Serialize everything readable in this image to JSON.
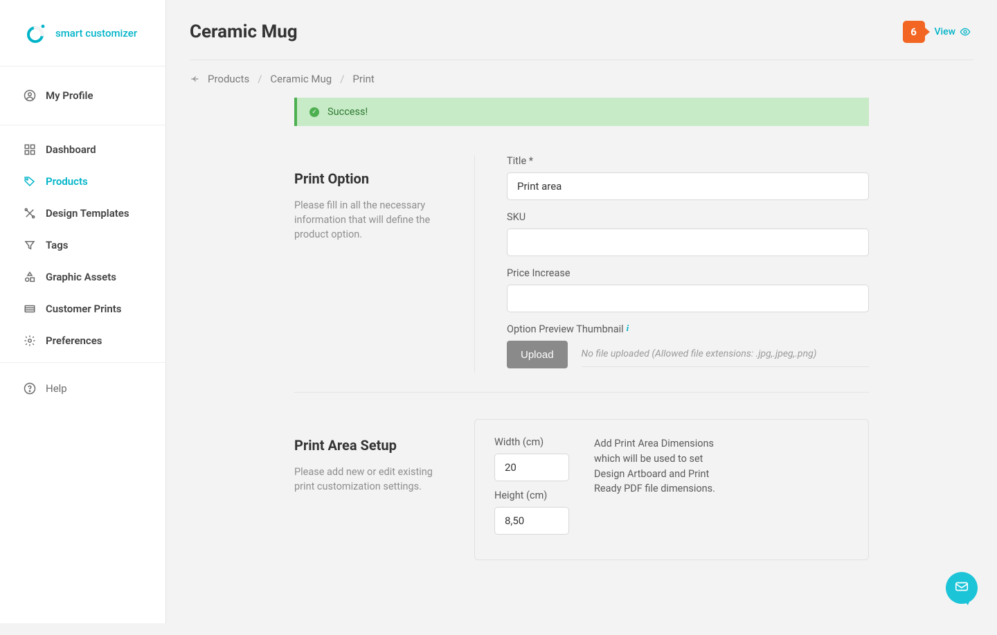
{
  "brand": {
    "name": "smart customizer"
  },
  "sidebar": {
    "profile": "My Profile",
    "items": [
      {
        "label": "Dashboard"
      },
      {
        "label": "Products"
      },
      {
        "label": "Design Templates"
      },
      {
        "label": "Tags"
      },
      {
        "label": "Graphic Assets"
      },
      {
        "label": "Customer Prints"
      },
      {
        "label": "Preferences"
      }
    ],
    "help": "Help"
  },
  "header": {
    "title": "Ceramic Mug",
    "credits": "6",
    "view_label": "View"
  },
  "breadcrumb": {
    "products": "Products",
    "product": "Ceramic Mug",
    "current": "Print"
  },
  "alert": {
    "text": "Success!"
  },
  "print_option": {
    "heading": "Print Option",
    "description": "Please fill in all the necessary information that will define the product option.",
    "title_label": "Title *",
    "title_value": "Print area",
    "sku_label": "SKU",
    "sku_value": "",
    "price_label": "Price Increase",
    "price_value": "",
    "thumb_label": "Option Preview Thumbnail",
    "upload_label": "Upload",
    "upload_meta": "No file uploaded (Allowed file extensions: .jpg,.jpeg,.png)"
  },
  "print_area": {
    "heading": "Print Area Setup",
    "description": "Please add new or edit existing print customization settings.",
    "width_label": "Width (cm)",
    "width_value": "20",
    "height_label": "Height (cm)",
    "height_value": "8,50",
    "hint": "Add Print Area Dimensions which will be used to set Design Artboard and Print Ready PDF file dimensions."
  }
}
